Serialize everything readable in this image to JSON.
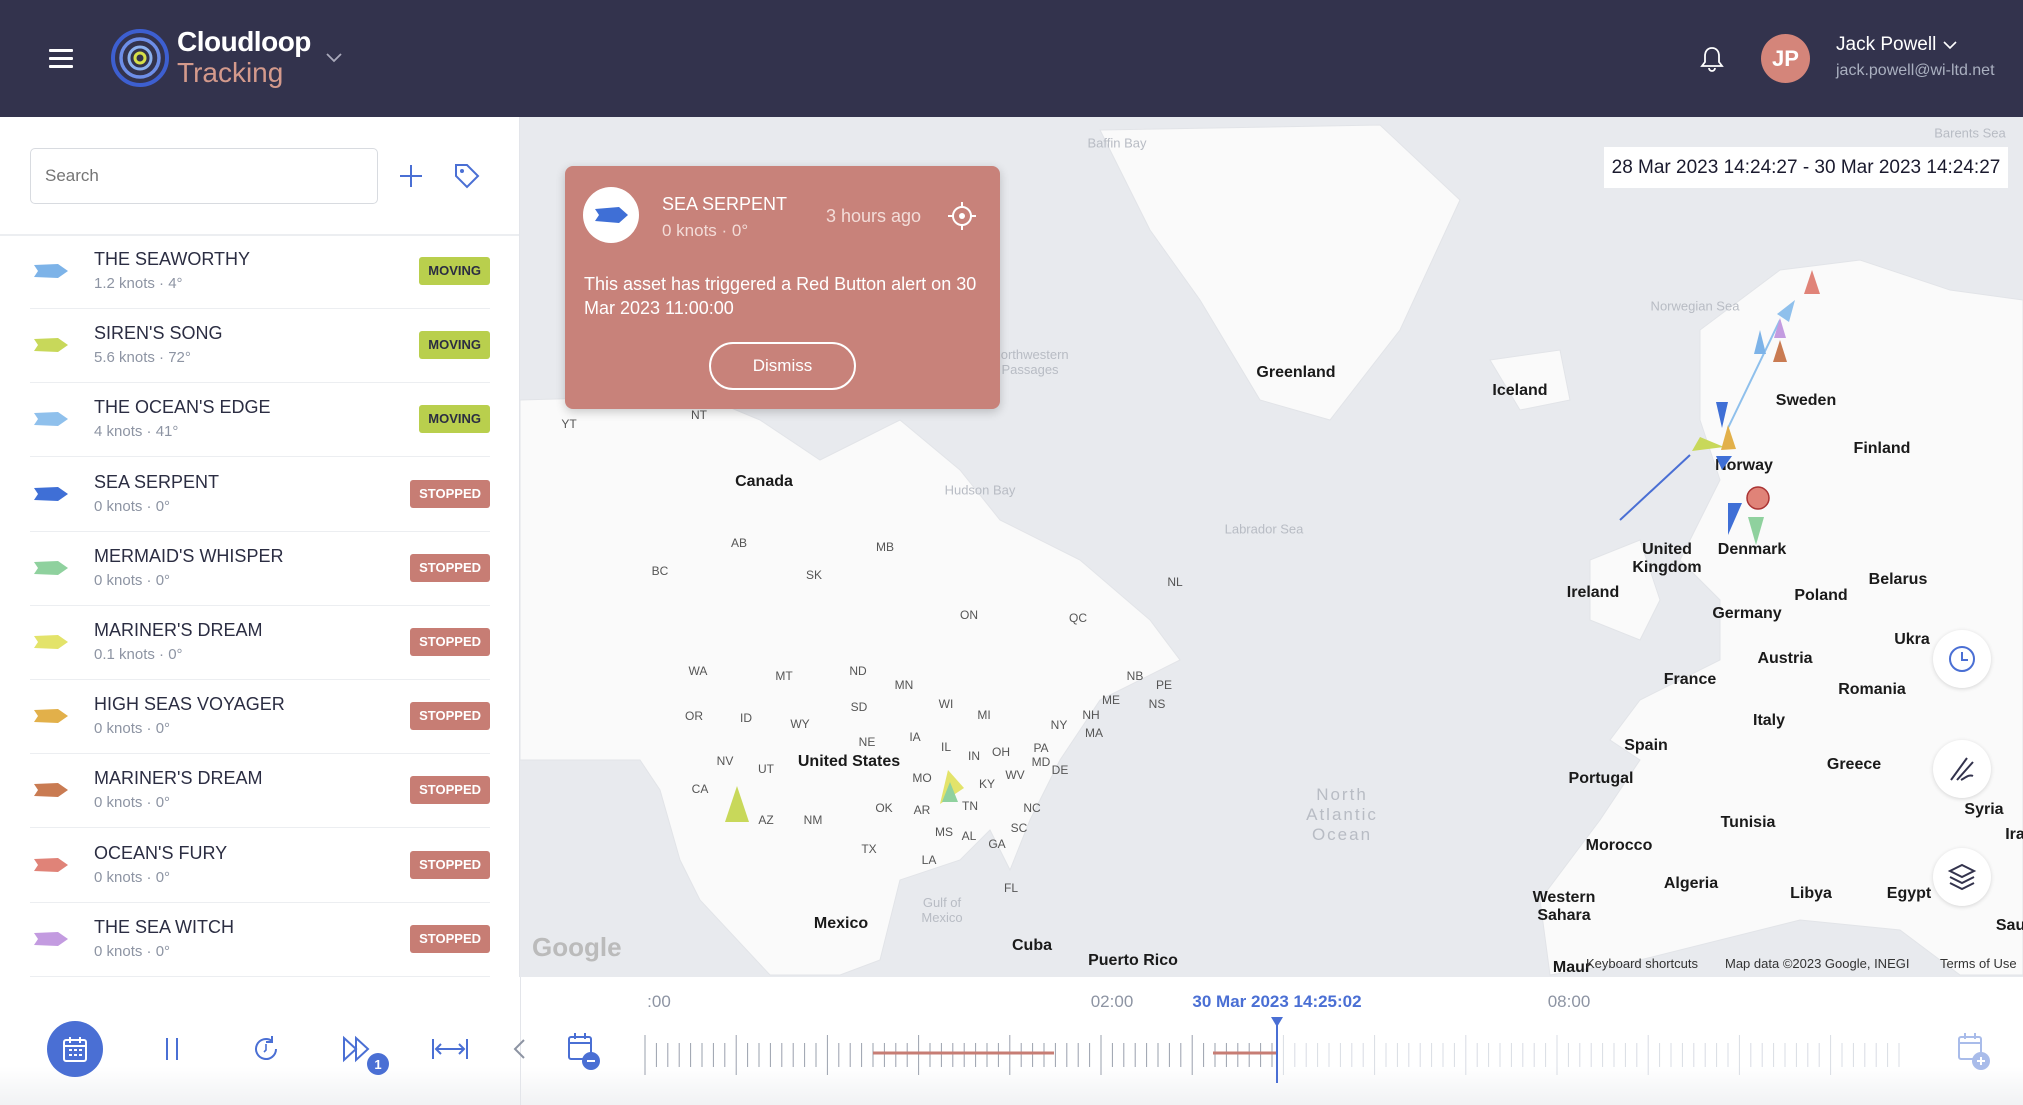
{
  "header": {
    "app_name_line1": "Cloudloop",
    "app_name_line2": "Tracking",
    "user_name": "Jack Powell",
    "user_email": "jack.powell@wi-ltd.net",
    "avatar_initials": "JP",
    "avatar_color": "#d4857a"
  },
  "sidebar": {
    "search_placeholder": "Search",
    "assets": [
      {
        "name": "THE SEAWORTHY",
        "speed": "1.2 knots",
        "heading": "4°",
        "status": "MOVING",
        "color": "#7db3e8"
      },
      {
        "name": "SIREN'S SONG",
        "speed": "5.6 knots",
        "heading": "72°",
        "status": "MOVING",
        "color": "#c8d85a"
      },
      {
        "name": "THE OCEAN'S EDGE",
        "speed": "4 knots",
        "heading": "41°",
        "status": "MOVING",
        "color": "#8fc0ec"
      },
      {
        "name": "SEA SERPENT",
        "speed": "0 knots",
        "heading": "0°",
        "status": "STOPPED",
        "color": "#3f6fd6"
      },
      {
        "name": "MERMAID'S WHISPER",
        "speed": "0 knots",
        "heading": "0°",
        "status": "STOPPED",
        "color": "#8fd19e"
      },
      {
        "name": "MARINER'S DREAM",
        "speed": "0.1 knots",
        "heading": "0°",
        "status": "STOPPED",
        "color": "#e3e36a"
      },
      {
        "name": "HIGH SEAS VOYAGER",
        "speed": "0 knots",
        "heading": "0°",
        "status": "STOPPED",
        "color": "#e2b04a"
      },
      {
        "name": "MARINER'S DREAM",
        "speed": "0 knots",
        "heading": "0°",
        "status": "STOPPED",
        "color": "#c97b52"
      },
      {
        "name": "OCEAN'S FURY",
        "speed": "0 knots",
        "heading": "0°",
        "status": "STOPPED",
        "color": "#e08378"
      },
      {
        "name": "THE SEA WITCH",
        "speed": "0 knots",
        "heading": "0°",
        "status": "STOPPED",
        "color": "#c39be0"
      }
    ]
  },
  "popup": {
    "asset_name": "SEA SERPENT",
    "speed_heading": "0 knots · 0°",
    "time_ago": "3 hours ago",
    "message": "This asset has triggered a Red Button alert on 30 Mar 2023 11:00:00",
    "dismiss_label": "Dismiss",
    "color": "#c8827a"
  },
  "map": {
    "date_range": "28 Mar 2023 14:24:27 - 30 Mar 2023 14:24:27",
    "countries": [
      "Greenland",
      "Iceland",
      "Sweden",
      "Finland",
      "Norway",
      "Denmark",
      "United Kingdom",
      "Ireland",
      "Poland",
      "Belarus",
      "Germany",
      "Ukra",
      "France",
      "Austria",
      "Romania",
      "Italy",
      "Spain",
      "Portugal",
      "Greece",
      "Tunisia",
      "Syria",
      "Morocco",
      "Algeria",
      "Libya",
      "Egypt",
      "Western Sahara",
      "Canada",
      "United States",
      "Mexico",
      "Cuba",
      "Puerto Rico",
      "Ira",
      "Sauc",
      "Maur"
    ],
    "seas": [
      "Baffin Bay",
      "Hudson Bay",
      "Labrador Sea",
      "North Atlantic Ocean",
      "Norwegian Sea",
      "Barents Sea",
      "Northwestern Passages",
      "Gulf of Mexico"
    ],
    "regions": [
      "WA",
      "MT",
      "ND",
      "OR",
      "ID",
      "WY",
      "SD",
      "MN",
      "WI",
      "MI",
      "NE",
      "IA",
      "NV",
      "UT",
      "IL",
      "IN",
      "OH",
      "PA",
      "NY",
      "CA",
      "AZ",
      "NM",
      "MO",
      "KY",
      "WV",
      "MD",
      "DE",
      "OK",
      "AR",
      "TN",
      "NC",
      "SC",
      "MS",
      "AL",
      "GA",
      "TX",
      "LA",
      "FL",
      "MA",
      "NH",
      "ME",
      "NB",
      "NS",
      "PE",
      "QC",
      "ON",
      "NL",
      "MB",
      "SK",
      "AB",
      "BC",
      "NT",
      "YT"
    ],
    "google_logo": "Google",
    "footer": {
      "shortcuts": "Keyboard shortcuts",
      "map_data": "Map data ©2023 Google, INEGI",
      "terms": "Terms of Use"
    },
    "controls": [
      "clock-icon",
      "draw-icon",
      "layers-icon"
    ]
  },
  "timeline": {
    "labels": [
      ":00",
      "02:00",
      "08:00"
    ],
    "current": "30 Mar 2023 14:25:02",
    "speed_badge": "1",
    "accent": "#4a6fd4",
    "alert_color": "#c77d74"
  }
}
